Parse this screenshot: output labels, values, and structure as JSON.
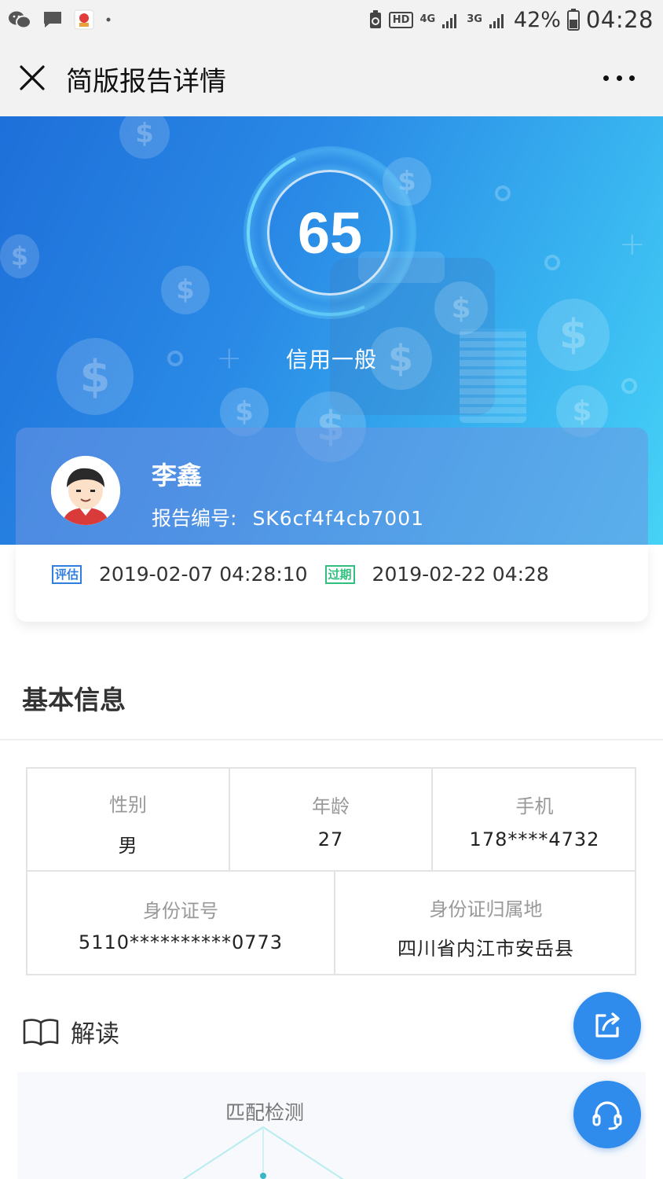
{
  "status_bar": {
    "hd_label": "HD",
    "network_a": "4G",
    "network_b": "3G",
    "battery": "42%",
    "time": "04:28"
  },
  "title_bar": {
    "title": "简版报告详情"
  },
  "hero": {
    "score": "65",
    "credit_level": "信用一般"
  },
  "user": {
    "name": "李鑫",
    "report_no_label": "报告编号:",
    "report_no": "SK6cf4f4cb7001",
    "eval_badge": "评估",
    "eval_time": "2019-02-07 04:28:10",
    "expire_badge": "过期",
    "expire_time": "2019-02-22 04:28"
  },
  "basic_info": {
    "title": "基本信息",
    "gender_label": "性别",
    "gender": "男",
    "age_label": "年龄",
    "age": "27",
    "phone_label": "手机",
    "phone": "178****4732",
    "id_label": "身份证号",
    "id": "5110**********0773",
    "id_location_label": "身份证归属地",
    "id_location": "四川省内江市安岳县"
  },
  "interpretation": {
    "title": "解读",
    "match_title": "匹配检测"
  },
  "colors": {
    "accent": "#2f8bec",
    "eval_badge": "#2f7fe0",
    "expire_badge": "#2fc07f"
  }
}
